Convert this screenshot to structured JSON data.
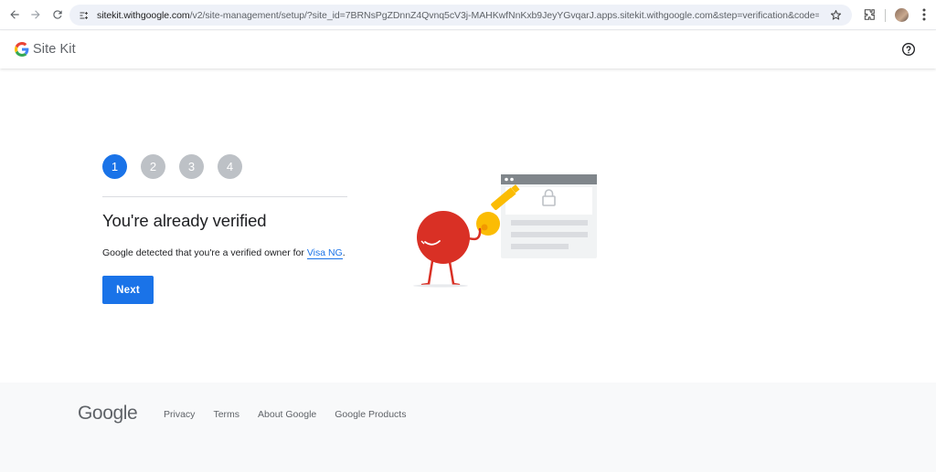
{
  "browser": {
    "url_host": "sitekit.withgoogle.com",
    "url_path": "/v2/site-management/setup/?site_id=7BRNsPgZDnnZ4Qvnq5cV3j-MAHKwfNnKxb9JeyYGvqarJ.apps.sitekit.withgoogle.com&step=verification&code=sitekit-EhIKB1Nlc3N..."
  },
  "header": {
    "app_name": "Site Kit",
    "help_icon": "help-circle-icon"
  },
  "stepper": {
    "steps": [
      "1",
      "2",
      "3",
      "4"
    ],
    "active_step": 1
  },
  "main": {
    "title": "You're already verified",
    "description_prefix": "Google detected that you're a verified owner for ",
    "site_link": "Visa NG",
    "description_suffix": ".",
    "next_label": "Next"
  },
  "footer": {
    "logo_text": "Google",
    "links": [
      "Privacy",
      "Terms",
      "About Google",
      "Google Products"
    ]
  },
  "colors": {
    "primary": "#1a73e8",
    "step_inactive": "#bdc1c6",
    "footer_bg": "#f8f9fa"
  }
}
